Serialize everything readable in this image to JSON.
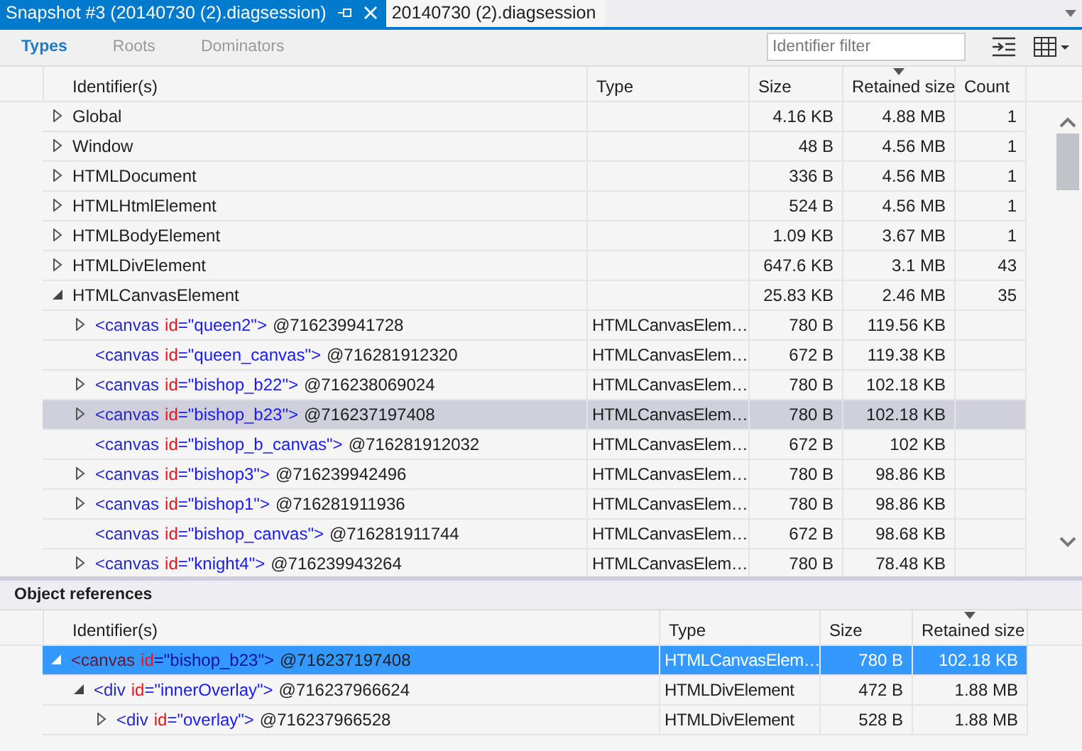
{
  "tabs": [
    {
      "label": "Snapshot #3 (20140730 (2).diagsession)",
      "selected": true
    },
    {
      "label": "20140730 (2).diagsession",
      "selected": false
    }
  ],
  "view_tabs": [
    {
      "label": "Types",
      "selected": true
    },
    {
      "label": "Roots",
      "selected": false
    },
    {
      "label": "Dominators",
      "selected": false
    }
  ],
  "filter": {
    "placeholder": "Identifier filter"
  },
  "types_table": {
    "columns": [
      {
        "label": "Identifier(s)",
        "sorted": false
      },
      {
        "label": "Type",
        "sorted": false
      },
      {
        "label": "Size",
        "sorted": false
      },
      {
        "label": "Retained size",
        "sorted": true
      },
      {
        "label": "Count",
        "sorted": false
      }
    ],
    "rows": [
      {
        "kind": "type",
        "label": "Global",
        "expanded": false,
        "selected": false,
        "size": "4.16 KB",
        "retained": "4.88 MB",
        "count": "1"
      },
      {
        "kind": "type",
        "label": "Window",
        "expanded": false,
        "selected": false,
        "size": "48 B",
        "retained": "4.56 MB",
        "count": "1"
      },
      {
        "kind": "type",
        "label": "HTMLDocument",
        "expanded": false,
        "selected": false,
        "size": "336 B",
        "retained": "4.56 MB",
        "count": "1"
      },
      {
        "kind": "type",
        "label": "HTMLHtmlElement",
        "expanded": false,
        "selected": false,
        "size": "524 B",
        "retained": "4.56 MB",
        "count": "1"
      },
      {
        "kind": "type",
        "label": "HTMLBodyElement",
        "expanded": false,
        "selected": false,
        "size": "1.09 KB",
        "retained": "3.67 MB",
        "count": "1"
      },
      {
        "kind": "type",
        "label": "HTMLDivElement",
        "expanded": false,
        "selected": false,
        "size": "647.6 KB",
        "retained": "3.1 MB",
        "count": "43"
      },
      {
        "kind": "type",
        "label": "HTMLCanvasElement",
        "expanded": true,
        "selected": false,
        "size": "25.83 KB",
        "retained": "2.46 MB",
        "count": "35",
        "children": [
          {
            "kind": "instance",
            "tag": "<canvas",
            "attr": "id",
            "value": "=\"queen2\">",
            "address": "@716239941728",
            "type": "HTMLCanvasElem…",
            "size": "780 B",
            "retained": "119.56 KB",
            "expanded": false,
            "selected": false
          },
          {
            "kind": "instance",
            "tag": "<canvas",
            "attr": "id",
            "value": "=\"queen_canvas\">",
            "address": "@716281912320",
            "type": "HTMLCanvasElem…",
            "size": "672 B",
            "retained": "119.38 KB",
            "selected": false
          },
          {
            "kind": "instance",
            "tag": "<canvas",
            "attr": "id",
            "value": "=\"bishop_b22\">",
            "address": "@716238069024",
            "type": "HTMLCanvasElem…",
            "size": "780 B",
            "retained": "102.18 KB",
            "expanded": false,
            "selected": false
          },
          {
            "kind": "instance",
            "tag": "<canvas",
            "attr": "id",
            "value": "=\"bishop_b23\">",
            "address": "@716237197408",
            "type": "HTMLCanvasElem…",
            "size": "780 B",
            "retained": "102.18 KB",
            "expanded": false,
            "selected": true
          },
          {
            "kind": "instance",
            "tag": "<canvas",
            "attr": "id",
            "value": "=\"bishop_b_canvas\">",
            "address": "@716281912032",
            "type": "HTMLCanvasElem…",
            "size": "672 B",
            "retained": "102 KB",
            "selected": false
          },
          {
            "kind": "instance",
            "tag": "<canvas",
            "attr": "id",
            "value": "=\"bishop3\">",
            "address": "@716239942496",
            "type": "HTMLCanvasElem…",
            "size": "780 B",
            "retained": "98.86 KB",
            "expanded": false,
            "selected": false
          },
          {
            "kind": "instance",
            "tag": "<canvas",
            "attr": "id",
            "value": "=\"bishop1\">",
            "address": "@716281911936",
            "type": "HTMLCanvasElem…",
            "size": "780 B",
            "retained": "98.86 KB",
            "expanded": false,
            "selected": false
          },
          {
            "kind": "instance",
            "tag": "<canvas",
            "attr": "id",
            "value": "=\"bishop_canvas\">",
            "address": "@716281911744",
            "type": "HTMLCanvasElem…",
            "size": "672 B",
            "retained": "98.68 KB",
            "selected": false
          },
          {
            "kind": "instance",
            "tag": "<canvas",
            "attr": "id",
            "value": "=\"knight4\">",
            "address": "@716239943264",
            "type": "HTMLCanvasElem…",
            "size": "780 B",
            "retained": "78.48 KB",
            "expanded": false,
            "selected": false
          }
        ]
      }
    ]
  },
  "references": {
    "title": "Object references",
    "columns": [
      {
        "label": "Identifier(s)",
        "sorted": false
      },
      {
        "label": "Type",
        "sorted": false
      },
      {
        "label": "Size",
        "sorted": false
      },
      {
        "label": "Retained size",
        "sorted": true
      }
    ],
    "rows": [
      {
        "kind": "instance",
        "tag": "<canvas",
        "attr": "id",
        "value": "=\"bishop_b23\">",
        "address": "@716237197408",
        "type": "HTMLCanvasElem…",
        "size": "780 B",
        "retained": "102.18 KB",
        "expanded": true,
        "selected": true,
        "children": [
          {
            "kind": "instance",
            "tag": "<div",
            "attr": "id",
            "value": "=\"innerOverlay\">",
            "address": "@716237966624",
            "type": "HTMLDivElement",
            "size": "472 B",
            "retained": "1.88 MB",
            "expanded": true,
            "selected": false,
            "children": [
              {
                "kind": "instance",
                "tag": "<div",
                "attr": "id",
                "value": "=\"overlay\">",
                "address": "@716237966528",
                "type": "HTMLDivElement",
                "size": "528 B",
                "retained": "1.88 MB",
                "expanded": false,
                "selected": false
              }
            ]
          }
        ]
      }
    ]
  }
}
